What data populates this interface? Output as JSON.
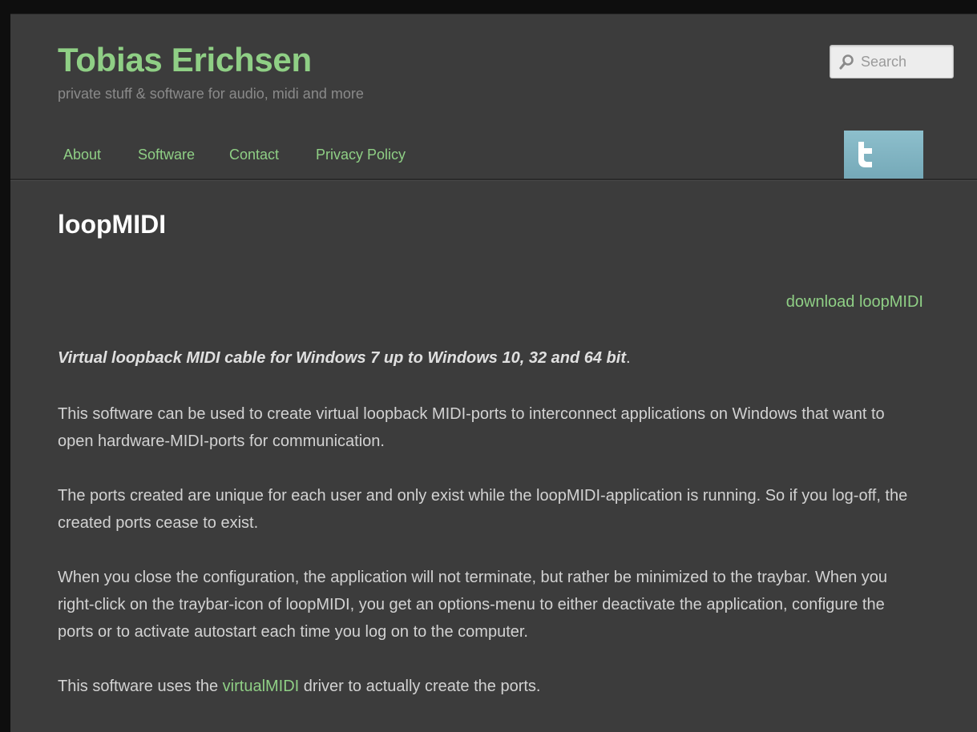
{
  "header": {
    "site_title": "Tobias Erichsen",
    "tagline": "private stuff & software for audio, midi and more",
    "search": {
      "placeholder": "Search",
      "icon": "search-icon"
    }
  },
  "nav": {
    "items": [
      {
        "label": "About"
      },
      {
        "label": "Software"
      },
      {
        "label": "Contact"
      },
      {
        "label": "Privacy Policy"
      }
    ],
    "twitter_icon": "twitter-icon"
  },
  "main": {
    "title": "loopMIDI",
    "download_link": "download loopMIDI",
    "lead_text": "Virtual loopback MIDI cable for Windows 7 up to Windows 10, 32 and 64 bit",
    "lead_end": ".",
    "paragraphs": [
      "This software can be used to create virtual loopback MIDI-ports to interconnect applications on Windows that want to open hardware-MIDI-ports for communication.",
      "The ports created are unique for each user and only exist while the loopMIDI-application is running.  So if you log-off, the created ports cease to exist.",
      "When you close the configuration, the application will not terminate, but rather be minimized to the traybar.  When you right-click on the traybar-icon of loopMIDI, you get an options-menu to either deactivate the application, configure the ports or to activate autostart each time you log on to the computer."
    ],
    "driver_sentence": {
      "before": "This software uses the ",
      "link": "virtualMIDI",
      "after": " driver to actually create the ports."
    }
  },
  "colors": {
    "background": "#3c3c3c",
    "accent": "#8fcf85",
    "twitter": "#7fb3c2"
  }
}
